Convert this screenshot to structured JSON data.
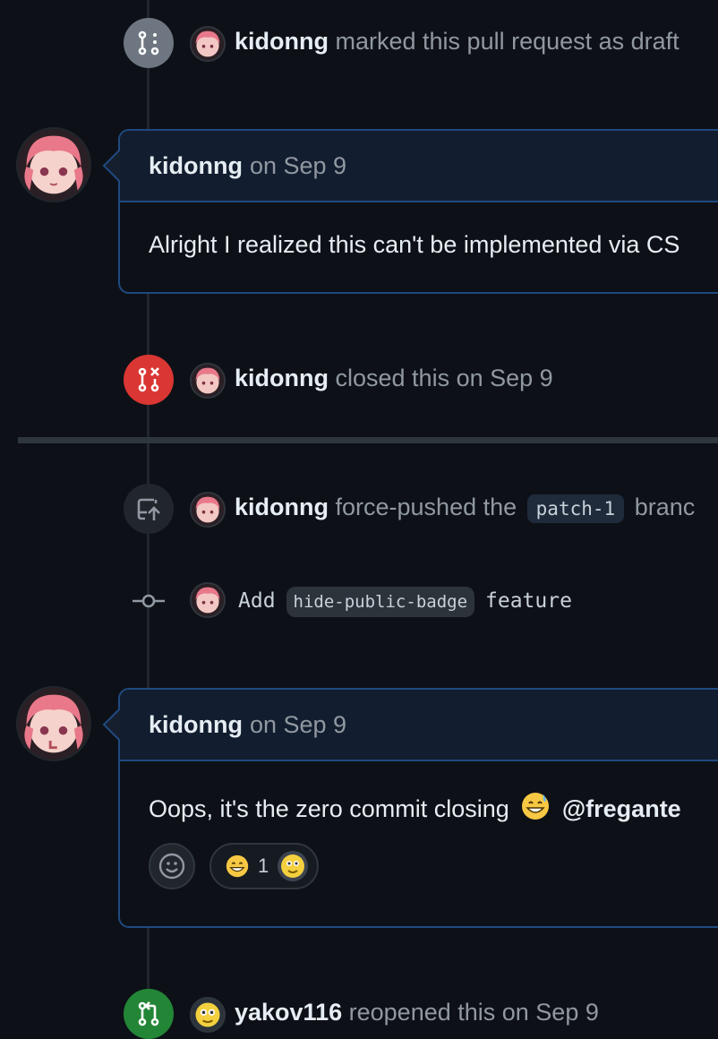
{
  "events": {
    "draft": {
      "actor": "kidonng",
      "action": "marked this pull request as draft"
    },
    "closed": {
      "actor": "kidonng",
      "action": "closed this on Sep 9"
    },
    "force_push": {
      "actor": "kidonng",
      "action": "force-pushed the",
      "branch": "patch-1",
      "suffix": "branc"
    },
    "reopened": {
      "actor": "yakov116",
      "action": "reopened this on Sep 9"
    }
  },
  "comments": [
    {
      "author": "kidonng",
      "date": "on Sep 9",
      "body": "Alright I realized this can't be implemented via CS"
    },
    {
      "author": "kidonng",
      "date": "on Sep 9",
      "body": "Oops, it's the zero commit closing",
      "mention": "@fregante",
      "reaction": {
        "emoji": "grinning-face",
        "count": "1"
      }
    }
  ],
  "commit": {
    "prefix": "Add",
    "code": "hide-public-badge",
    "suffix": "feature"
  },
  "icons": {
    "draft": "git-pull-request-draft-icon",
    "closed": "git-pull-request-closed-icon",
    "force_push": "repo-push-icon",
    "commit": "git-commit-icon",
    "reopened": "git-pull-request-icon",
    "add_reaction": "smiley-icon"
  },
  "colors": {
    "background": "#0d1117",
    "draft_badge": "#6e7681",
    "closed_badge": "#da3633",
    "reopened_badge": "#238636",
    "comment_border": "#1f4a80",
    "comment_header": "#121d2f"
  }
}
